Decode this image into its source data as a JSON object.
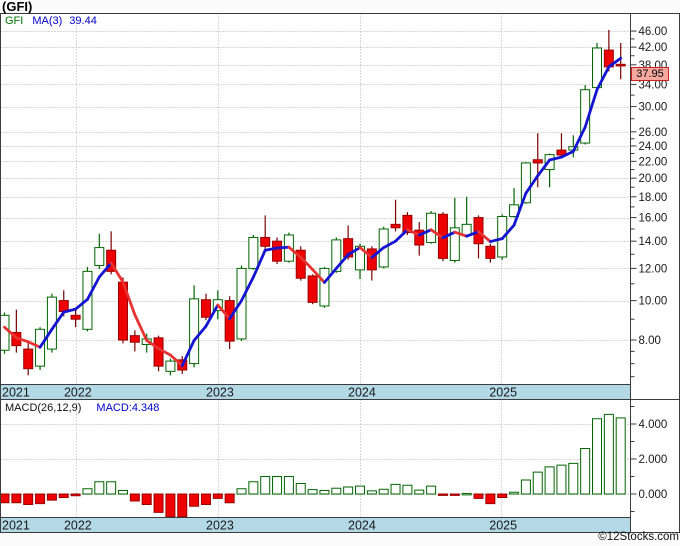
{
  "title": "(GFI)",
  "footer": {
    "copyright": "©12Stocks.com"
  },
  "main_panel": {
    "legend": {
      "symbol": "GFI",
      "ma_label": "MA(3)",
      "ma_value": "39.44"
    },
    "last_price_label": "37.95"
  },
  "macd_panel": {
    "legend": {
      "name": "MACD(26,12,9)",
      "value": "MACD:4.348"
    }
  },
  "colors": {
    "background": "#fbfbfb",
    "panel_bg": "#ffffff",
    "axis_band": "#b3d9e6",
    "frame": "#3c3c3c",
    "grid": "#b0b0b0",
    "up_candle_border": "#006600",
    "up_candle_fill": "#ffffff",
    "up_wick": "#006600",
    "down_candle_fill": "#ee0000",
    "down_candle_border": "#990000",
    "down_wick": "#7a0000",
    "ma_up": "#1414d2",
    "ma_down": "#e83232",
    "macd_pos_border": "#006600",
    "macd_pos_fill": "#ffffff",
    "macd_neg_fill": "#ee0000",
    "macd_neg_border": "#990000",
    "price_label_bg": "#f5a99f",
    "price_label_border": "#cc2222",
    "axis_text": "#1a1a1a"
  },
  "chart_data": [
    {
      "type": "candlestick",
      "title": "GFI monthly candlesticks with MA(3), log price scale",
      "y_scale": "log",
      "ylim": [
        6.3,
        48
      ],
      "y_ticks_major": [
        46,
        42,
        38,
        34,
        30,
        26,
        24,
        22,
        20,
        18,
        16,
        14,
        12,
        10,
        8
      ],
      "y_ticks_minor": [
        44,
        40,
        36,
        32,
        28,
        25,
        23,
        21,
        19,
        17,
        15,
        13,
        11,
        9,
        7.5,
        7,
        6.5
      ],
      "x_year_ticks": [
        {
          "label": "2021",
          "index": -0.2,
          "gridline": false
        },
        {
          "label": "2022",
          "index": 6.03,
          "gridline": true
        },
        {
          "label": "2023",
          "index": 18.02,
          "gridline": true
        },
        {
          "label": "2024",
          "index": 30.0,
          "gridline": true
        },
        {
          "label": "2025",
          "index": 41.92,
          "gridline": true
        }
      ],
      "last_price": 37.95,
      "ohlc": [
        [
          7.55,
          9.35,
          7.4,
          9.2
        ],
        [
          8.35,
          9.5,
          7.45,
          7.75
        ],
        [
          7.6,
          7.9,
          6.55,
          6.8
        ],
        [
          6.9,
          8.6,
          6.75,
          8.5
        ],
        [
          7.6,
          10.4,
          7.45,
          10.2
        ],
        [
          10.0,
          10.6,
          9.15,
          9.4
        ],
        [
          9.2,
          9.55,
          8.6,
          9.0
        ],
        [
          8.5,
          12.1,
          8.4,
          11.8
        ],
        [
          12.2,
          14.6,
          11.95,
          13.5
        ],
        [
          13.3,
          14.8,
          11.6,
          11.8
        ],
        [
          11.1,
          11.4,
          7.85,
          8.0
        ],
        [
          8.2,
          8.45,
          7.5,
          7.9
        ],
        [
          7.8,
          8.3,
          7.45,
          8.05
        ],
        [
          8.1,
          8.2,
          6.7,
          6.9
        ],
        [
          6.7,
          7.2,
          6.55,
          7.1
        ],
        [
          7.15,
          7.3,
          6.6,
          6.75
        ],
        [
          7.0,
          10.9,
          6.85,
          10.1
        ],
        [
          10.05,
          10.4,
          8.95,
          9.1
        ],
        [
          9.45,
          10.6,
          9.0,
          10.05
        ],
        [
          10.0,
          10.25,
          7.6,
          7.95
        ],
        [
          8.05,
          12.2,
          7.95,
          12.0
        ],
        [
          12.0,
          14.5,
          11.9,
          14.3
        ],
        [
          14.3,
          16.2,
          13.4,
          13.6
        ],
        [
          14.0,
          14.3,
          12.3,
          12.5
        ],
        [
          12.5,
          14.7,
          12.4,
          14.5
        ],
        [
          13.3,
          13.6,
          11.2,
          11.35
        ],
        [
          11.5,
          11.6,
          9.8,
          9.9
        ],
        [
          9.7,
          12.1,
          9.6,
          12.0
        ],
        [
          11.8,
          14.3,
          11.7,
          14.1
        ],
        [
          14.2,
          15.3,
          12.6,
          12.8
        ],
        [
          11.9,
          13.8,
          11.3,
          13.6
        ],
        [
          13.4,
          13.6,
          11.2,
          11.9
        ],
        [
          12.1,
          15.2,
          12.0,
          15.0
        ],
        [
          15.4,
          17.7,
          14.8,
          15.1
        ],
        [
          16.2,
          16.5,
          14.5,
          14.7
        ],
        [
          14.9,
          15.6,
          12.9,
          13.7
        ],
        [
          13.9,
          16.6,
          13.8,
          16.4
        ],
        [
          16.3,
          16.5,
          12.5,
          12.7
        ],
        [
          12.55,
          17.9,
          12.4,
          15.1
        ],
        [
          14.5,
          18.0,
          14.3,
          15.4
        ],
        [
          16.0,
          16.2,
          12.7,
          13.8
        ],
        [
          13.6,
          13.8,
          12.4,
          12.7
        ],
        [
          12.8,
          16.3,
          12.6,
          16.1
        ],
        [
          16.1,
          18.9,
          16.0,
          17.2
        ],
        [
          17.4,
          21.9,
          17.3,
          21.8
        ],
        [
          22.2,
          25.8,
          19.0,
          21.8
        ],
        [
          21.0,
          23.0,
          19.0,
          22.85
        ],
        [
          23.45,
          25.8,
          22.4,
          22.8
        ],
        [
          23.45,
          25.5,
          22.5,
          23.9
        ],
        [
          24.4,
          33.9,
          24.2,
          33.0
        ],
        [
          33.4,
          43.0,
          33.2,
          41.8
        ],
        [
          41.3,
          46.3,
          36.6,
          37.55
        ],
        [
          38.1,
          43.0,
          35.0,
          37.95
        ]
      ],
      "ma3": [
        8.6,
        8.1,
        7.92,
        7.68,
        8.5,
        9.37,
        9.53,
        10.07,
        11.43,
        12.37,
        11.1,
        9.23,
        7.98,
        7.62,
        7.35,
        6.92,
        7.98,
        8.65,
        9.75,
        9.03,
        10.0,
        11.42,
        13.3,
        13.47,
        13.53,
        12.78,
        11.92,
        11.08,
        12.0,
        12.97,
        13.5,
        12.77,
        13.5,
        14.0,
        14.93,
        14.5,
        14.93,
        14.27,
        14.73,
        14.4,
        14.77,
        13.97,
        14.2,
        15.33,
        18.37,
        20.27,
        22.17,
        22.53,
        23.27,
        26.7,
        33.0,
        37.57,
        39.44
      ]
    },
    {
      "type": "bar",
      "title": "MACD(26,12,9) histogram",
      "ylim": [
        -1.6,
        5
      ],
      "y_ticks_major": [
        {
          "value": 4,
          "label": "4.000"
        },
        {
          "value": 2,
          "label": "2.000"
        },
        {
          "value": 0,
          "label": "0.000"
        }
      ],
      "y_ticks_minor": [
        5,
        3,
        1,
        -1
      ],
      "last_value": 4.348,
      "values": [
        -0.5,
        -0.5,
        -0.6,
        -0.55,
        -0.35,
        -0.2,
        -0.1,
        0.3,
        0.7,
        0.7,
        0.2,
        -0.4,
        -0.6,
        -1.05,
        -1.3,
        -1.3,
        -0.7,
        -0.6,
        -0.25,
        -0.5,
        0.3,
        0.7,
        1.0,
        1.0,
        1.0,
        0.6,
        0.25,
        0.2,
        0.33,
        0.4,
        0.45,
        0.18,
        0.27,
        0.55,
        0.5,
        0.22,
        0.45,
        -0.05,
        -0.08,
        0.03,
        -0.25,
        -0.55,
        -0.2,
        0.1,
        0.8,
        1.25,
        1.55,
        1.65,
        1.75,
        2.6,
        4.3,
        4.55,
        4.348
      ]
    }
  ]
}
